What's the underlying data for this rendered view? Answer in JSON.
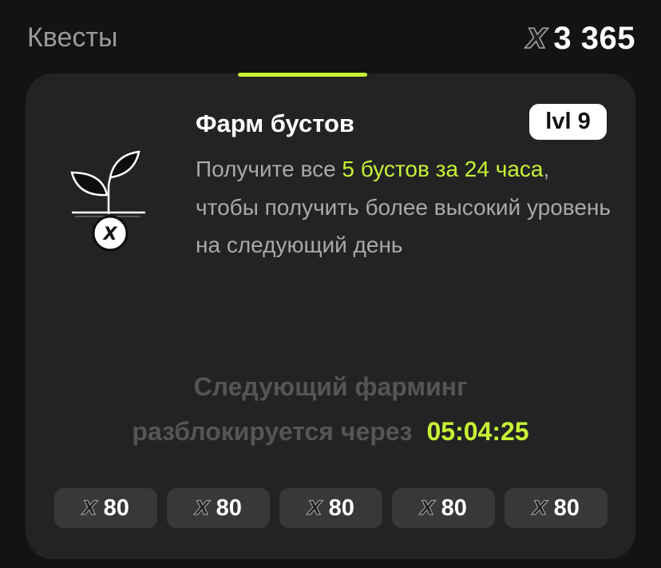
{
  "header": {
    "title": "Квесты",
    "balance_icon": "x-token-icon",
    "balance": "3 365"
  },
  "quest": {
    "icon": "sprout-x-icon",
    "title": "Фарм бустов",
    "level": "lvl 9",
    "description": {
      "part1": "Получите все ",
      "highlight": "5 бустов за 24 часа",
      "part2": ", чтобы получить более высокий уровень на следующий день"
    }
  },
  "next_farming": {
    "line1": "Следующий фарминг",
    "line2": "разблокируется через",
    "timer": "05:04:25"
  },
  "rewards": [
    {
      "icon": "x-token-icon",
      "value": "80"
    },
    {
      "icon": "x-token-icon",
      "value": "80"
    },
    {
      "icon": "x-token-icon",
      "value": "80"
    },
    {
      "icon": "x-token-icon",
      "value": "80"
    },
    {
      "icon": "x-token-icon",
      "value": "80"
    }
  ],
  "colors": {
    "accent": "#c6f236",
    "background": "#131313",
    "card": "#232323",
    "pill": "#383838"
  }
}
